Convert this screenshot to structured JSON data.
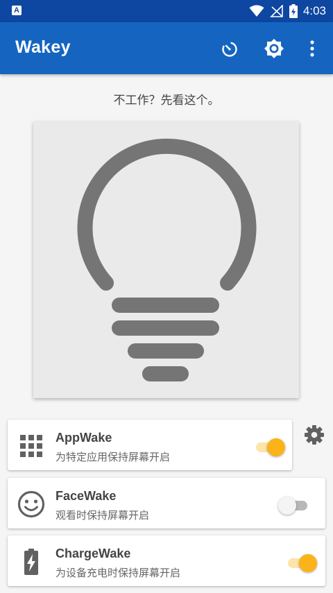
{
  "status_bar": {
    "time": "4:03",
    "notification_letter": "A"
  },
  "app_bar": {
    "title": "Wakey",
    "actions": [
      "timer-icon",
      "brightness-icon",
      "more-vert-icon"
    ]
  },
  "hint_text": "不工作？先看这个。",
  "bulb": {
    "icon": "lightbulb-icon",
    "color": "#757575",
    "background": "#eaeaea"
  },
  "modes": [
    {
      "title": "AppWake",
      "subtitle": "为特定应用保持屏幕开启",
      "icon": "apps-grid-icon",
      "enabled": true
    },
    {
      "title": "FaceWake",
      "subtitle": "观看时保持屏幕开启",
      "icon": "face-icon",
      "enabled": false
    },
    {
      "title": "ChargeWake",
      "subtitle": "为设备充电时保持屏幕开启",
      "icon": "battery-charging-icon",
      "enabled": true
    }
  ],
  "colors": {
    "status_bar": "#0d47a1",
    "app_bar": "#1565c0",
    "accent": "#fbb31a",
    "icon_gray": "#616161"
  }
}
